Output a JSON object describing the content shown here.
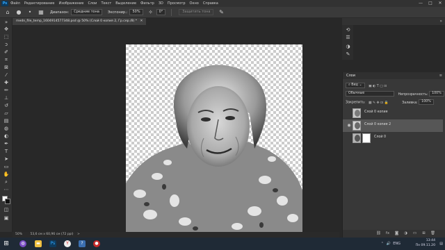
{
  "menubar": {
    "items": [
      "Файл",
      "Редактирование",
      "Изображение",
      "Слои",
      "Текст",
      "Выделение",
      "Фильтр",
      "3D",
      "Просмотр",
      "Окно",
      "Справка"
    ],
    "window_controls": [
      "—",
      "□",
      "✕"
    ]
  },
  "options": {
    "range_label": "Диапазон:",
    "range_value": "Средние тона",
    "exposure_label": "Экспонир.:",
    "exposure_value": "50%",
    "angle_value": "0°",
    "protect_button": "Защитить тона"
  },
  "document": {
    "tab_title": "medn_file_temp_1604914577348.psd @ 50% (Слой 0 копия 2, Гр.сер./8) *",
    "tab_close": "✕"
  },
  "status": {
    "zoom": "50%",
    "size": "53,6 см x 60,96 см (72 ppi)",
    "arrow": ">"
  },
  "layers_panel": {
    "title": "Слои",
    "menu": "≡",
    "filter_value": "Вид",
    "blend_mode": "Обычные",
    "opacity_label": "Непрозрачность:",
    "opacity_value": "100%",
    "lock_label": "Закрепить:",
    "fill_label": "Заливка:",
    "fill_value": "100%",
    "layers": [
      {
        "name": "Слой 0 копия",
        "visible": false,
        "selected": false
      },
      {
        "name": "Слой 0 копия 2",
        "visible": true,
        "selected": true
      },
      {
        "name": "Слой 0",
        "visible": false,
        "selected": false
      }
    ],
    "footer_icons": [
      "link-icon",
      "fx-icon",
      "mask-icon",
      "adjustment-icon",
      "folder-icon",
      "new-layer-icon",
      "trash-icon"
    ]
  },
  "taskbar": {
    "time": "13:44",
    "date": "Пн 09.11.20",
    "lang": "ENG",
    "ps_label": "Ps"
  }
}
